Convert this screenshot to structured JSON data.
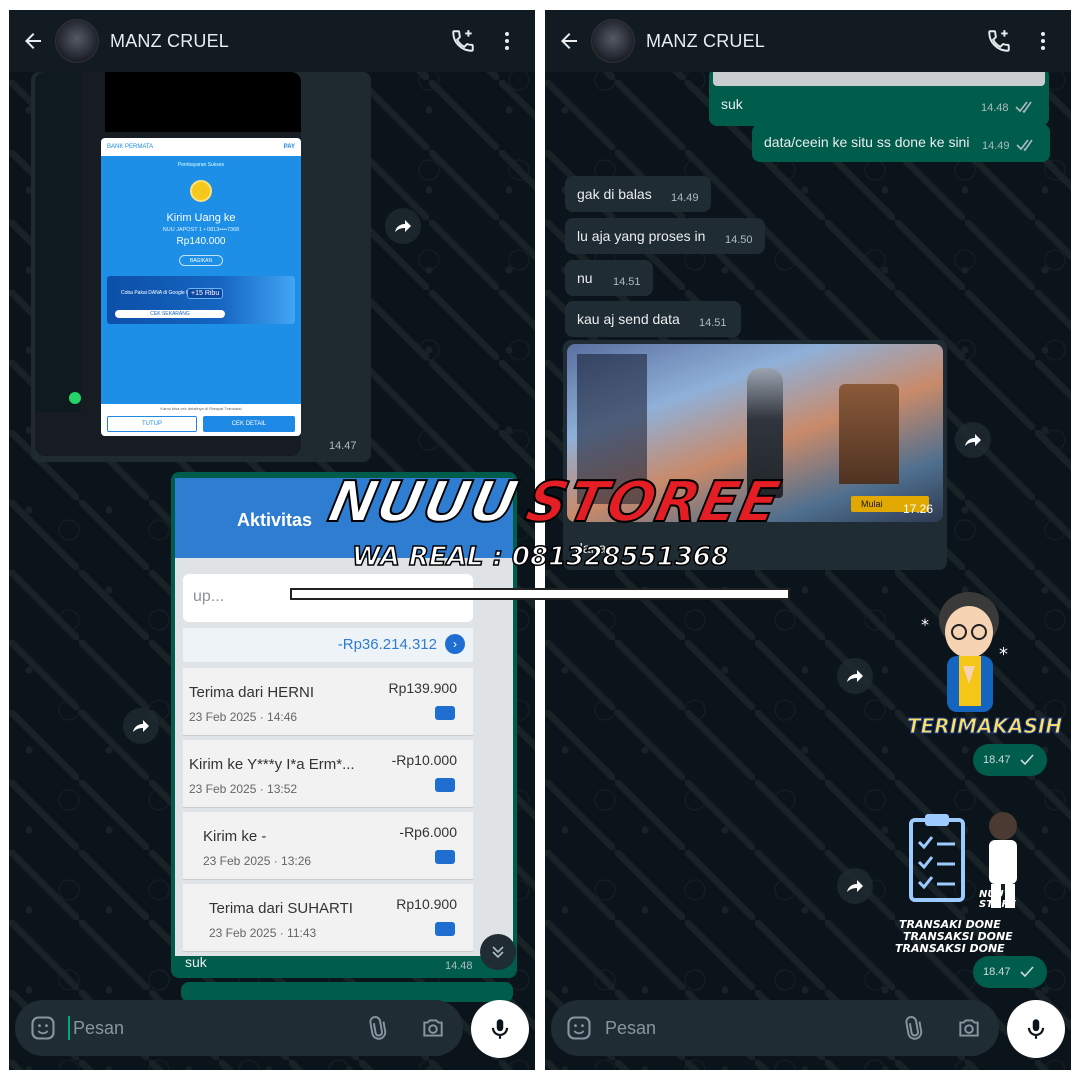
{
  "left": {
    "contact_name": "MANZ CRUEL",
    "dana_receipt": {
      "header_left": "BANK PERMATA",
      "header_right": "PAY",
      "subtitle": "Pembayaran Sukses",
      "title": "Kirim Uang ke",
      "recipient": "NUU JAPOST 1 • 0813••••7368",
      "amount": "Rp140.000",
      "share_label": "BAGIKAN",
      "ad_text": "Coba Pakai DANA di Google Play",
      "ad_badge": "+15 Ribu",
      "ad_button": "CEK SEKARANG",
      "footer_note": "Kamu bisa cek detailnya di Riwayat Transaksi",
      "btn_close": "TUTUP",
      "btn_detail": "CEK DETAIL"
    },
    "image_time": "14.47",
    "activity": {
      "header": "Aktivitas",
      "search_placeholder": "up...",
      "total": "-Rp36.214.312",
      "rows": [
        {
          "name": "Terima dari HERNI",
          "date": "23 Feb 2025 · 14:46",
          "amount": "Rp139.900"
        },
        {
          "name": "Kirim ke Y***y I*a Erm*...",
          "date": "23 Feb 2025 · 13:52",
          "amount": "-Rp10.000"
        },
        {
          "name": "Kirim ke -",
          "date": "23 Feb 2025 · 13:26",
          "amount": "-Rp6.000"
        },
        {
          "name": "Terima dari SUHARTI",
          "date": "23 Feb 2025 · 11:43",
          "amount": "Rp10.900"
        }
      ]
    },
    "activity_caption": "suk",
    "activity_time": "14.48",
    "composer_placeholder": "Pesan"
  },
  "right": {
    "contact_name": "MANZ CRUEL",
    "messages": [
      {
        "dir": "out",
        "text": "suk",
        "time": "14.48"
      },
      {
        "dir": "out",
        "text": "data/ceein ke situ ss done ke sini",
        "time": "14.49"
      },
      {
        "dir": "in",
        "text": "gak di balas",
        "time": "14.49"
      },
      {
        "dir": "in",
        "text": "lu aja yang proses in",
        "time": "14.50"
      },
      {
        "dir": "in",
        "text": "nu",
        "time": "14.51"
      },
      {
        "dir": "in",
        "text": "kau aj send data",
        "time": "14.51"
      }
    ],
    "game_image_time": "17.26",
    "game_label": "Mulai",
    "game_caption": "dana",
    "sticker1_label": "TERIMAKASIH",
    "sticker1_time": "18.47",
    "sticker2_lines": [
      "TRANSAKI DONE",
      "TRANSAKSI DONE",
      "TRANSAKSI DONE"
    ],
    "sticker2_brand": "NUU STORE",
    "sticker2_time": "18.47",
    "composer_placeholder": "Pesan"
  },
  "watermark": {
    "word1": "NUUU",
    "word2": "STOREE",
    "sub": "WA REAL : 081328551368"
  },
  "colors": {
    "outgoing_bubble": "#005c4b",
    "incoming_bubble": "#202c33",
    "background": "#0b141a",
    "header": "#111b21",
    "accent": "#00a884"
  },
  "icons": [
    "back-arrow-icon",
    "add-call-icon",
    "more-vert-icon",
    "forward-icon",
    "emoji-icon",
    "attach-icon",
    "camera-icon",
    "mic-icon",
    "double-check-icon",
    "scroll-down-icon"
  ]
}
